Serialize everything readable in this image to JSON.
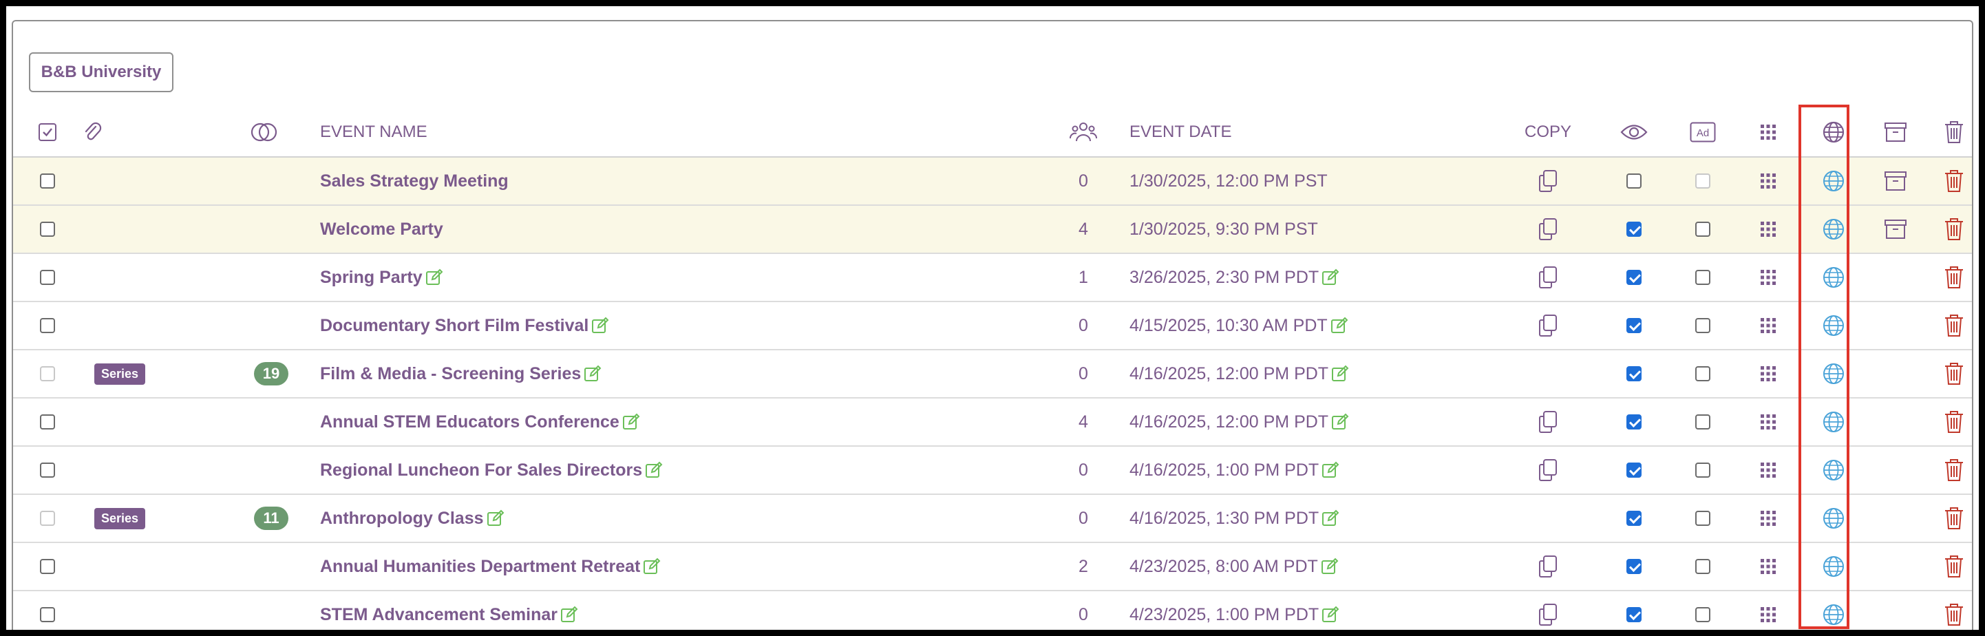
{
  "org_button_label": "B&B University",
  "header": {
    "event_name": "EVENT NAME",
    "event_date": "EVENT DATE",
    "copy": "COPY",
    "ad_label": "Ad"
  },
  "rows": [
    {
      "name": "Sales Strategy Meeting",
      "attendees": "0",
      "date": "1/30/2025, 12:00 PM PST",
      "editable": false,
      "copy": true,
      "public": false,
      "ad": "disabled",
      "archive": true,
      "series": false,
      "highlight": true
    },
    {
      "name": "Welcome Party",
      "attendees": "4",
      "date": "1/30/2025, 9:30 PM PST",
      "editable": false,
      "copy": true,
      "public": true,
      "ad": "empty",
      "archive": true,
      "series": false,
      "highlight": true
    },
    {
      "name": "Spring Party",
      "attendees": "1",
      "date": "3/26/2025, 2:30 PM PDT",
      "editable": true,
      "copy": true,
      "public": true,
      "ad": "empty",
      "archive": false,
      "series": false,
      "highlight": false
    },
    {
      "name": "Documentary Short Film Festival",
      "attendees": "0",
      "date": "4/15/2025, 10:30 AM PDT",
      "editable": true,
      "copy": true,
      "public": true,
      "ad": "empty",
      "archive": false,
      "series": false,
      "highlight": false
    },
    {
      "name": "Film & Media - Screening Series",
      "attendees": "0",
      "date": "4/16/2025, 12:00 PM PDT",
      "editable": true,
      "copy": false,
      "public": true,
      "ad": "empty",
      "archive": false,
      "series": true,
      "series_label": "Series",
      "series_count": "19",
      "highlight": false
    },
    {
      "name": "Annual STEM Educators Conference",
      "attendees": "4",
      "date": "4/16/2025, 12:00 PM PDT",
      "editable": true,
      "copy": true,
      "public": true,
      "ad": "empty",
      "archive": false,
      "series": false,
      "highlight": false
    },
    {
      "name": "Regional Luncheon For Sales Directors",
      "attendees": "0",
      "date": "4/16/2025, 1:00 PM PDT",
      "editable": true,
      "copy": true,
      "public": true,
      "ad": "empty",
      "archive": false,
      "series": false,
      "highlight": false
    },
    {
      "name": "Anthropology Class",
      "attendees": "0",
      "date": "4/16/2025, 1:30 PM PDT",
      "editable": true,
      "copy": false,
      "public": true,
      "ad": "empty",
      "archive": false,
      "series": true,
      "series_label": "Series",
      "series_count": "11",
      "highlight": false
    },
    {
      "name": "Annual Humanities Department Retreat",
      "attendees": "2",
      "date": "4/23/2025, 8:00 AM PDT",
      "editable": true,
      "copy": true,
      "public": true,
      "ad": "empty",
      "archive": false,
      "series": false,
      "highlight": false
    },
    {
      "name": "STEM Advancement Seminar",
      "attendees": "0",
      "date": "4/23/2025, 1:00 PM PDT",
      "editable": true,
      "copy": true,
      "public": true,
      "ad": "empty",
      "archive": false,
      "series": false,
      "highlight": false
    }
  ],
  "colors": {
    "brand_purple": "#7b5a8c",
    "edit_green": "#6bbf59",
    "web_blue": "#4aa3d8",
    "delete_red": "#c0392b",
    "series_green": "#6c9a70",
    "highlight_row": "#faf8e6",
    "selection_red": "#e0352b"
  },
  "icons": {
    "select_all": "checkbox-select-all-icon",
    "attachment": "paperclip-icon",
    "series": "overlapping-circles-icon",
    "attendees": "people-group-icon",
    "visibility": "eye-icon",
    "ad": "ad-icon",
    "qr": "qr-dots-icon",
    "web": "globe-icon",
    "archive": "archive-box-icon",
    "delete": "trash-icon",
    "copy": "copy-icon",
    "edit": "edit-pencil-icon"
  }
}
